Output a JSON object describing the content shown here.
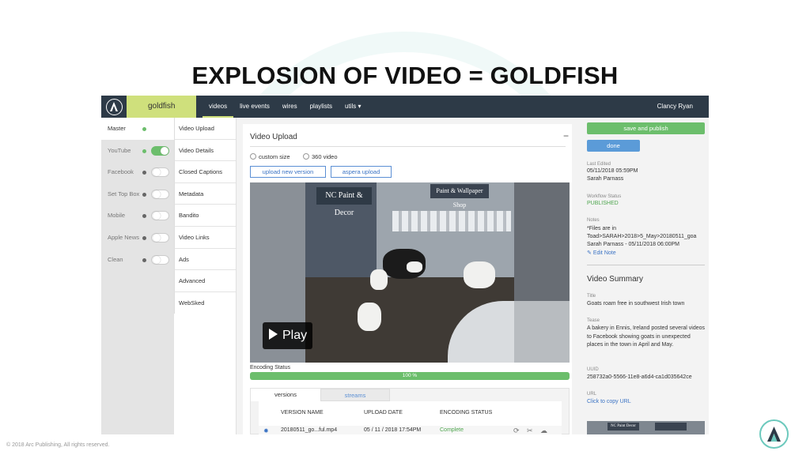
{
  "slide": {
    "title": "EXPLOSION OF VIDEO = GOLDFISH",
    "footer": "© 2018 Arc Publishing, All rights reserved."
  },
  "topbar": {
    "site_name": "goldfish",
    "nav": [
      "videos",
      "live events",
      "wires",
      "playlists",
      "utils ▾"
    ],
    "user_name": "Clancy Ryan"
  },
  "sidebar": {
    "items": [
      {
        "label": "Master",
        "dot": "green",
        "toggle": null
      },
      {
        "label": "YouTube",
        "dot": "green",
        "toggle": "on"
      },
      {
        "label": "Facebook",
        "dot": "gray",
        "toggle": "off"
      },
      {
        "label": "Set Top Box",
        "dot": "gray",
        "toggle": "off"
      },
      {
        "label": "Mobile",
        "dot": "gray",
        "toggle": "off"
      },
      {
        "label": "Apple News",
        "dot": "gray",
        "toggle": "off"
      },
      {
        "label": "Clean",
        "dot": "gray",
        "toggle": "off"
      }
    ]
  },
  "subnav": {
    "items": [
      "Video Upload",
      "Video Details",
      "Closed Captions",
      "Metadata",
      "Bandito",
      "Video Links",
      "Ads",
      "Advanced",
      "WebSked"
    ]
  },
  "upload": {
    "title": "Video Upload",
    "collapse_glyph": "−",
    "custom_size_label": "custom size",
    "video_360_label": "360 video",
    "upload_new_label": "upload new version",
    "aspera_label": "aspera upload",
    "sign_left": "NC Paint & Decor",
    "sign_right": "Paint & Wallpaper Shop",
    "play_label": "Play",
    "encoding_label": "Encoding Status",
    "progress_percent": 100,
    "progress_text": "100 %"
  },
  "versions": {
    "tabs": [
      "versions",
      "streams"
    ],
    "headers": [
      "VERSION NAME",
      "UPLOAD DATE",
      "ENCODING STATUS"
    ],
    "row": {
      "name": "20180511_go...ful.mp4",
      "date": "05 / 11 / 2018 17:54PM",
      "status": "Complete"
    }
  },
  "right": {
    "save_label": "save and publish",
    "done_label": "done",
    "last_edited_label": "Last Edited",
    "last_edited_date": "05/11/2018 05:59PM",
    "last_edited_user": "Sarah Parnass",
    "workflow_label": "Workflow Status",
    "workflow_value": "PUBLISHED",
    "notes_label": "Notes",
    "notes_line1": "*Files are in",
    "notes_line2": "Toad>SARAH>2018>5_May>20180511_goa",
    "notes_line3": "Sarah Parnass - 05/11/2018 06:00PM",
    "edit_note_label": "Edit Note",
    "summary_heading": "Video Summary",
    "title_label": "Title",
    "title_value": "Goats roam free in southwest Irish town",
    "tease_label": "Tease",
    "tease_value": "A bakery in Ennis, Ireland posted several videos to Facebook showing goats in unexpected places in the town in April and May.",
    "uuid_label": "UUID",
    "uuid_value": "258732a0-5566-11e8-a6d4-ca1d035642ce",
    "url_label": "URL",
    "url_value": "Click to copy URL",
    "thumb_sign": "NC Paint Decor"
  },
  "colors": {
    "topbar": "#2d3a47",
    "accent": "#cfe07c",
    "green": "#6cbe6c",
    "blue": "#5b9bd8"
  }
}
